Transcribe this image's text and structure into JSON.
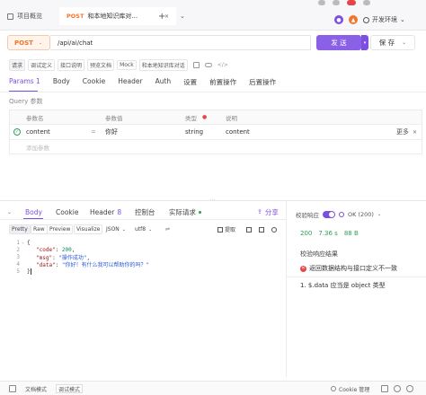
{
  "tabbar": {
    "overview_label": "项目概览",
    "tab_method": "POST",
    "tab_title": "和本地知识库对...",
    "close_glyph": "✕",
    "add_glyph": "+",
    "more_glyph": "⌄",
    "env_label": "开发环境",
    "env_caret": "⌄"
  },
  "request": {
    "method": "POST",
    "url": "/api/ai/chat",
    "send_label": "发 送",
    "save_label": "保 存",
    "send_caret": "▾",
    "save_caret": "⌄"
  },
  "subnav": {
    "items": [
      "请求",
      "调试定义",
      "接口说明",
      "预览文档",
      "Mock",
      "和本地知识库对话"
    ]
  },
  "request_tabs": {
    "items": [
      "Params 1",
      "Body",
      "Cookie",
      "Header",
      "Auth",
      "设置",
      "前置操作",
      "后置操作"
    ]
  },
  "query": {
    "label": "Query 参数",
    "headers": [
      "参数名",
      "参数值",
      "类型",
      "说明"
    ],
    "row": {
      "name": "content",
      "value": "你好",
      "type": "string",
      "desc": "content",
      "more": "更多",
      "eq": "="
    },
    "add_placeholder": "添加参数"
  },
  "split": {
    "handle": "⋯"
  },
  "response_tabs": {
    "body": "Body",
    "cookie": "Cookie",
    "header": "Header",
    "header_count": "8",
    "console": "控制台",
    "actual": "实际请求",
    "share": "分享"
  },
  "resp_toolbar": {
    "items": [
      "Pretty",
      "Raw",
      "Preview",
      "Visualize"
    ],
    "format": "JSON",
    "encoding": "utf8",
    "extract": "提取"
  },
  "code": {
    "line_numbers": [
      "1",
      "2",
      "3",
      "4",
      "5"
    ],
    "open": "{",
    "code_key": "\"code\"",
    "code_val": "200",
    "msg_key": "\"msg\"",
    "msg_val": "\"操作成功\"",
    "data_key": "\"data\"",
    "data_val": "\"你好！有什么我可以帮助你的吗？\"",
    "close": "}"
  },
  "validation": {
    "label": "校验响应",
    "status": "OK (200)",
    "code": "200",
    "time": "7.36 s",
    "size": "88 B",
    "result_title": "校验响应结果",
    "error": "返回数据结构与接口定义不一致",
    "detail": "1. $.data 应当是 object 类型"
  },
  "statusbar": {
    "doc_mode": "文档模式",
    "debug_mode": "调试模式",
    "cookie_label": "Cookie 管理"
  },
  "colors": {
    "accent": "#7b4fe0",
    "post": "#f1752c",
    "success": "#2e9e56",
    "error": "#e54545"
  }
}
